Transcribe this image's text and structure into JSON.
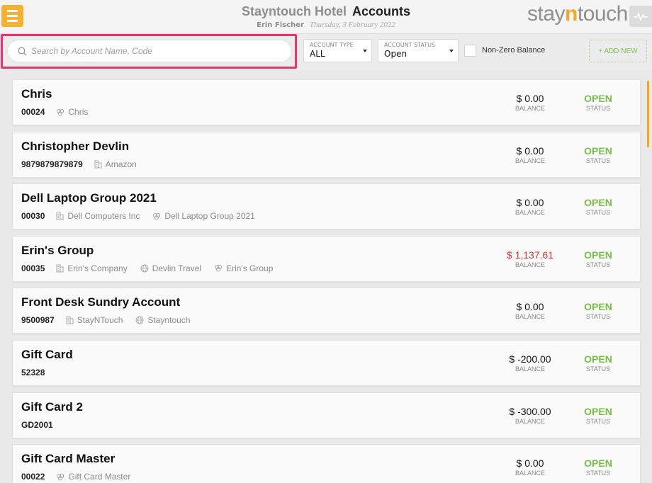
{
  "header": {
    "hotel_name": "Stayntouch Hotel",
    "page_title": "Accounts",
    "user_name": "Erin Fischer",
    "date": "Thursday, 3 February 2022",
    "logo_text_pre": "stay",
    "logo_text_n": "n",
    "logo_text_post": "touch",
    "menu_icon": "hamburger-icon",
    "activity_icon": "activity-pulse-icon"
  },
  "filters": {
    "search_placeholder": "Search by Account Name, Code",
    "account_type_label": "ACCOUNT TYPE",
    "account_type_value": "ALL",
    "account_status_label": "ACCOUNT STATUS",
    "account_status_value": "Open",
    "non_zero_label": "Non-Zero Balance",
    "non_zero_checked": false,
    "add_new_label": "+ ADD NEW"
  },
  "colors": {
    "accent": "#f5a623",
    "highlight": "#f2306e",
    "open_status": "#76c043",
    "negative_balance": "#d9302c"
  },
  "balance_caption": "BALANCE",
  "status_caption": "STATUS",
  "accounts": [
    {
      "name": "Chris",
      "code": "00024",
      "tags": [
        {
          "icon": "group-icon",
          "text": "Chris"
        }
      ],
      "balance": "$ 0.00",
      "negative": false,
      "status": "OPEN"
    },
    {
      "name": "Christopher Devlin",
      "code": "9879879879879",
      "tags": [
        {
          "icon": "company-icon",
          "text": "Amazon"
        }
      ],
      "balance": "$ 0.00",
      "negative": false,
      "status": "OPEN"
    },
    {
      "name": "Dell Laptop Group 2021",
      "code": "00030",
      "tags": [
        {
          "icon": "company-icon",
          "text": "Dell Computers Inc"
        },
        {
          "icon": "group-icon",
          "text": "Dell Laptop Group 2021"
        }
      ],
      "balance": "$ 0.00",
      "negative": false,
      "status": "OPEN"
    },
    {
      "name": "Erin's Group",
      "code": "00035",
      "tags": [
        {
          "icon": "company-icon",
          "text": "Erin's Company"
        },
        {
          "icon": "globe-icon",
          "text": "Devlin Travel"
        },
        {
          "icon": "group-icon",
          "text": "Erin's Group"
        }
      ],
      "balance": "$ 1,137.61",
      "negative": true,
      "status": "OPEN"
    },
    {
      "name": "Front Desk Sundry Account",
      "code": "9500987",
      "tags": [
        {
          "icon": "company-icon",
          "text": "StayNTouch"
        },
        {
          "icon": "globe-icon",
          "text": "Stayntouch"
        }
      ],
      "balance": "$ 0.00",
      "negative": false,
      "status": "OPEN"
    },
    {
      "name": "Gift Card",
      "code": "52328",
      "tags": [],
      "balance": "$ -200.00",
      "negative": false,
      "status": "OPEN"
    },
    {
      "name": "Gift Card 2",
      "code": "GD2001",
      "tags": [],
      "balance": "$ -300.00",
      "negative": false,
      "status": "OPEN"
    },
    {
      "name": "Gift Card Master",
      "code": "00022",
      "tags": [
        {
          "icon": "group-icon",
          "text": "Gift Card Master"
        }
      ],
      "balance": "$ 0.00",
      "negative": false,
      "status": "OPEN"
    }
  ]
}
